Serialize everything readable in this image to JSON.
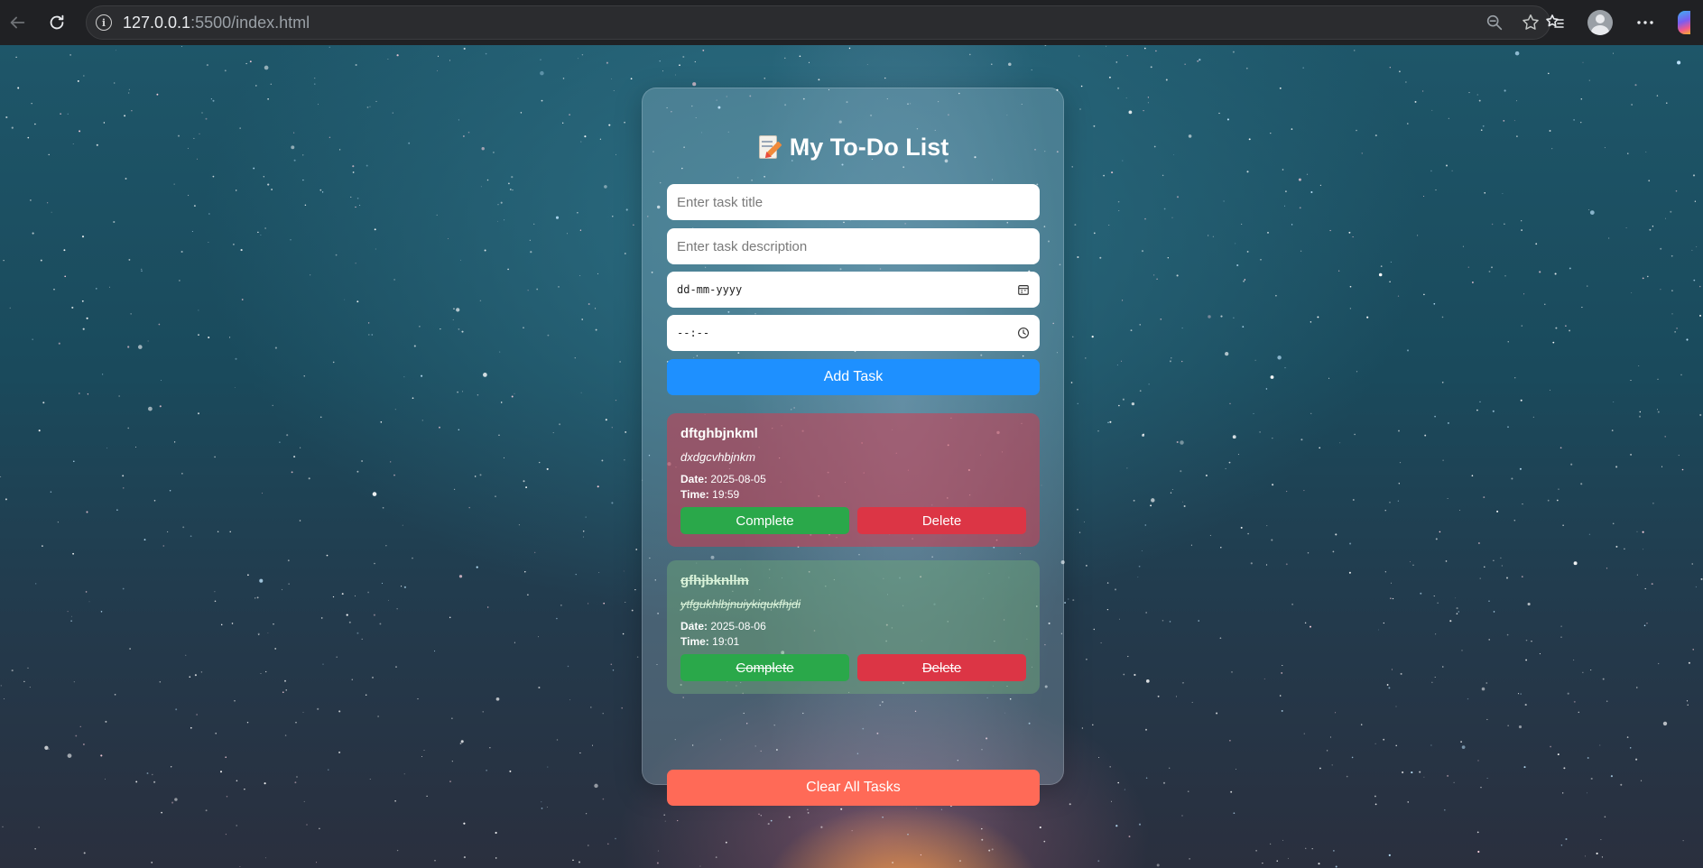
{
  "browser": {
    "url_host": "127.0.0.1",
    "url_rest": ":5500/index.html"
  },
  "app": {
    "title": "My To-Do List",
    "title_icon": "memo-icon"
  },
  "form": {
    "title_placeholder": "Enter task title",
    "description_placeholder": "Enter task description",
    "date_placeholder": "dd-mm-yyyy",
    "time_placeholder": "--:--",
    "add_label": "Add Task"
  },
  "tasks": [
    {
      "title": "dftghbjnkml",
      "description": "dxdgcvhbjnkm",
      "date_label": "Date:",
      "date": "2025-08-05",
      "time_label": "Time:",
      "time": "19:59",
      "complete_label": "Complete",
      "delete_label": "Delete",
      "status": "pending"
    },
    {
      "title": "gfhjbknllm",
      "description": "ytfgukhlbjnuiykiqukfhjdi",
      "date_label": "Date:",
      "date": "2025-08-06",
      "time_label": "Time:",
      "time": "19:01",
      "complete_label": "Complete",
      "delete_label": "Delete",
      "status": "completed"
    }
  ],
  "clear_label": "Clear All Tasks",
  "colors": {
    "add_button": "#1e90ff",
    "clear_button": "#ff6a57",
    "complete_button": "#2aa84a",
    "delete_button": "#dc3545"
  }
}
